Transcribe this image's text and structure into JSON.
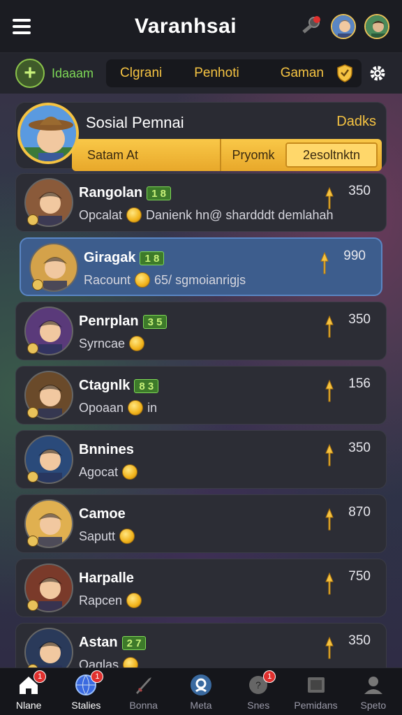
{
  "app": {
    "title": "Varanhsai"
  },
  "filter": {
    "label": "Idaaam",
    "tabs": [
      "Clgrani",
      "Penhoti",
      "Gaman"
    ]
  },
  "header": {
    "title": "Sosial Pemnai",
    "right_label": "Dadks",
    "bar_left": "Satam At",
    "bar_mid": "Pryomk",
    "bar_right": "2esoltnktn"
  },
  "rows": [
    {
      "name": "Rangolan",
      "level": "1 8",
      "sub": "Opcalat",
      "extra": "Danienk hn@ shardddt demlahah",
      "score": "350",
      "avatar_color": "#8a5a3a",
      "active": false
    },
    {
      "name": "Giragak",
      "level": "1 8",
      "sub": "Racount",
      "extra": "65/ sgmoianrigjs",
      "score": "990",
      "avatar_color": "#d4a24a",
      "active": true
    },
    {
      "name": "Penrplan",
      "level": "3 5",
      "sub": "Syrncae",
      "extra": "",
      "score": "350",
      "avatar_color": "#5a3a7a",
      "active": false
    },
    {
      "name": "Ctagnlk",
      "level": "8 3",
      "sub": "Opoaan",
      "extra": "in",
      "score": "156",
      "avatar_color": "#6a4a2a",
      "active": false
    },
    {
      "name": "Bnnines",
      "level": "",
      "sub": "Agocat",
      "extra": "",
      "score": "350",
      "avatar_color": "#2a4a7a",
      "active": false
    },
    {
      "name": "Camoe",
      "level": "",
      "sub": "Saputt",
      "extra": "",
      "score": "870",
      "avatar_color": "#e0b050",
      "active": false
    },
    {
      "name": "Harpalle",
      "level": "",
      "sub": "Rapcen",
      "extra": "",
      "score": "750",
      "avatar_color": "#7a3a2a",
      "active": false
    },
    {
      "name": "Astan",
      "level": "2 7",
      "sub": "Oaglas",
      "extra": "",
      "score": "350",
      "avatar_color": "#2a3a5a",
      "active": false
    }
  ],
  "nav": [
    {
      "label": "Nlane",
      "icon": "home-icon",
      "badge": "1",
      "active": true
    },
    {
      "label": "Stalies",
      "icon": "globe-icon",
      "badge": "1",
      "active": true
    },
    {
      "label": "Bonna",
      "icon": "sword-icon",
      "badge": "",
      "active": false
    },
    {
      "label": "Meta",
      "icon": "search-icon",
      "badge": "",
      "active": false
    },
    {
      "label": "Snes",
      "icon": "chat-icon",
      "badge": "1",
      "active": false
    },
    {
      "label": "Pemidans",
      "icon": "book-icon",
      "badge": "",
      "active": false
    },
    {
      "label": "Speto",
      "icon": "profile-icon",
      "badge": "",
      "active": false
    }
  ],
  "colors": {
    "accent": "#f5c342",
    "green": "#7ed957",
    "active_row": "#3d5d8d"
  }
}
